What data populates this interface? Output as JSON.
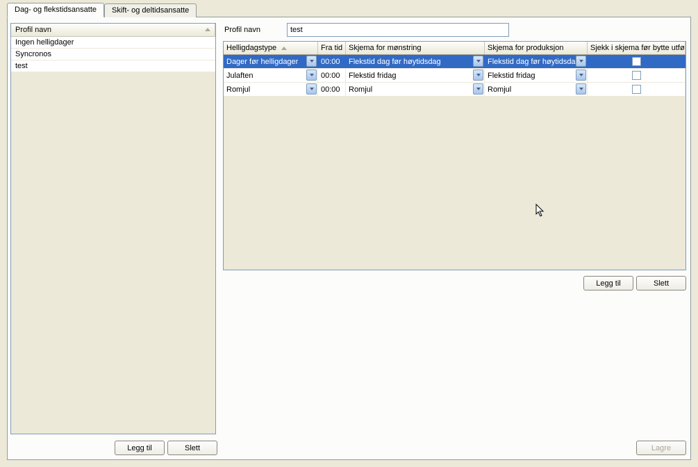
{
  "tabs": {
    "active": "Dag- og flekstidsansatte",
    "inactive": "Skift- og deltidsansatte"
  },
  "left": {
    "header": "Profil navn",
    "items": [
      {
        "label": "Ingen helligdager"
      },
      {
        "label": "Syncronos"
      },
      {
        "label": "test"
      }
    ],
    "add": "Legg til",
    "delete": "Slett"
  },
  "right": {
    "profil_label": "Profil navn",
    "profil_value": "test",
    "headers": {
      "c1": "Helligdagstype",
      "c2": "Fra tid",
      "c3": "Skjema for mønstring",
      "c4": "Skjema for produksjon",
      "c5": "Sjekk i skjema før bytte utføres"
    },
    "rows": [
      {
        "c1": "Dager før helligdager",
        "c2": "00:00",
        "c3": "Flekstid dag før høytidsdag",
        "c4": "Flekstid dag før høytidsdag",
        "selected": true
      },
      {
        "c1": "Julaften",
        "c2": "00:00",
        "c3": "Flekstid fridag",
        "c4": "Flekstid fridag",
        "selected": false
      },
      {
        "c1": "Romjul",
        "c2": "00:00",
        "c3": "Romjul",
        "c4": "Romjul",
        "selected": false
      }
    ],
    "add": "Legg til",
    "delete": "Slett",
    "save": "Lagre"
  }
}
